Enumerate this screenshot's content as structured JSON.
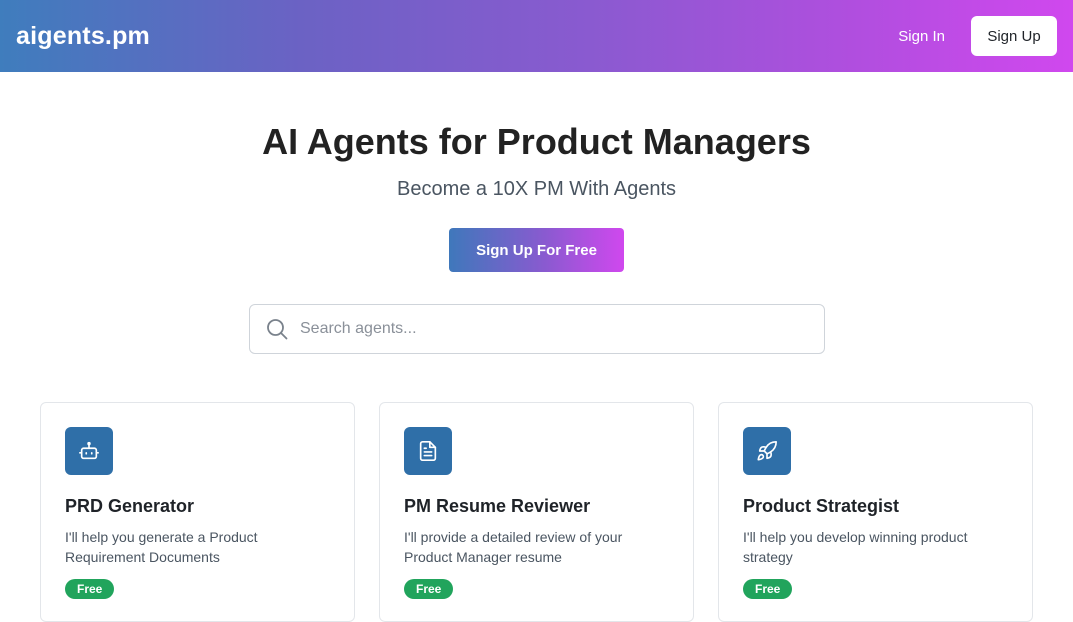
{
  "header": {
    "logo": "aigents.pm",
    "sign_in": "Sign In",
    "sign_up": "Sign Up"
  },
  "hero": {
    "title": "AI Agents for Product Managers",
    "subtitle": "Become a 10X PM With Agents",
    "cta": "Sign Up For Free"
  },
  "search": {
    "placeholder": "Search agents...",
    "value": ""
  },
  "cards": [
    {
      "icon": "robot-icon",
      "title": "PRD Generator",
      "description": "I'll help you generate a Product Requirement Documents",
      "badge": "Free"
    },
    {
      "icon": "document-icon",
      "title": "PM Resume Reviewer",
      "description": "I'll provide a detailed review of your Product Manager resume",
      "badge": "Free"
    },
    {
      "icon": "rocket-icon",
      "title": "Product Strategist",
      "description": "I'll help you develop winning product strategy",
      "badge": "Free"
    }
  ],
  "colors": {
    "gradient_start": "#3f7dbd",
    "gradient_end": "#d048ee",
    "icon_box": "#2f6fa8",
    "badge": "#21a45c"
  }
}
